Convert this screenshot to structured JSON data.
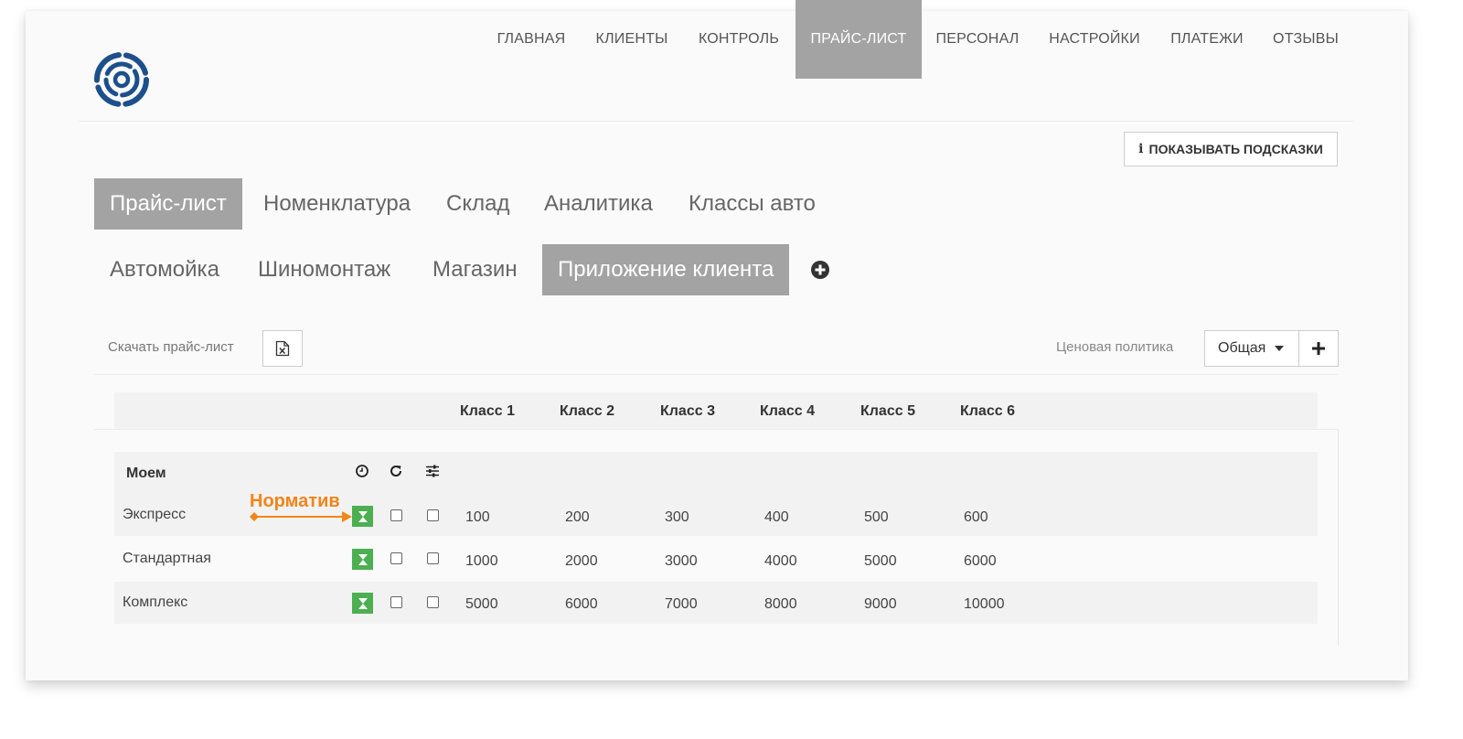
{
  "nav": {
    "items": [
      {
        "label": "ГЛАВНАЯ"
      },
      {
        "label": "КЛИЕНТЫ"
      },
      {
        "label": "КОНТРОЛЬ"
      },
      {
        "label": "ПРАЙС-ЛИСТ",
        "active": true
      },
      {
        "label": "ПЕРСОНАЛ"
      },
      {
        "label": "НАСТРОЙКИ"
      },
      {
        "label": "ПЛАТЕЖИ"
      },
      {
        "label": "ОТЗЫВЫ"
      }
    ]
  },
  "hints_button": {
    "icon": "info-icon",
    "label": "ПОКАЗЫВАТЬ ПОДСКАЗКИ"
  },
  "tabs_primary": [
    {
      "label": "Прайс-лист",
      "active": true
    },
    {
      "label": "Номенклатура"
    },
    {
      "label": "Склад"
    },
    {
      "label": "Аналитика"
    },
    {
      "label": "Классы авто"
    }
  ],
  "tabs_secondary": [
    {
      "label": "Автомойка"
    },
    {
      "label": "Шиномонтаж"
    },
    {
      "label": "Магазин"
    },
    {
      "label": "Приложение клиента",
      "active": true
    }
  ],
  "toolbar": {
    "download_label": "Скачать прайс-лист",
    "policy_label": "Ценовая политика",
    "policy_value": "Общая"
  },
  "table": {
    "columns": [
      "Класс 1",
      "Класс 2",
      "Класс 3",
      "Класс 4",
      "Класс 5",
      "Класс 6"
    ],
    "group": {
      "title": "Моем",
      "icons": [
        "clock-icon",
        "refresh-icon",
        "sliders-icon"
      ]
    },
    "rows": [
      {
        "name": "Экспресс",
        "values": [
          "100",
          "200",
          "300",
          "400",
          "500",
          "600"
        ]
      },
      {
        "name": "Стандартная",
        "values": [
          "1000",
          "2000",
          "3000",
          "4000",
          "5000",
          "6000"
        ]
      },
      {
        "name": "Комплекс",
        "values": [
          "5000",
          "6000",
          "7000",
          "8000",
          "9000",
          "10000"
        ]
      }
    ]
  },
  "annotation": {
    "label": "Норматив",
    "color": "#f08519"
  },
  "colors": {
    "active_tab": "#a3a3a3",
    "norm_button": "#4caf50",
    "logo": "#1d4f8c"
  }
}
